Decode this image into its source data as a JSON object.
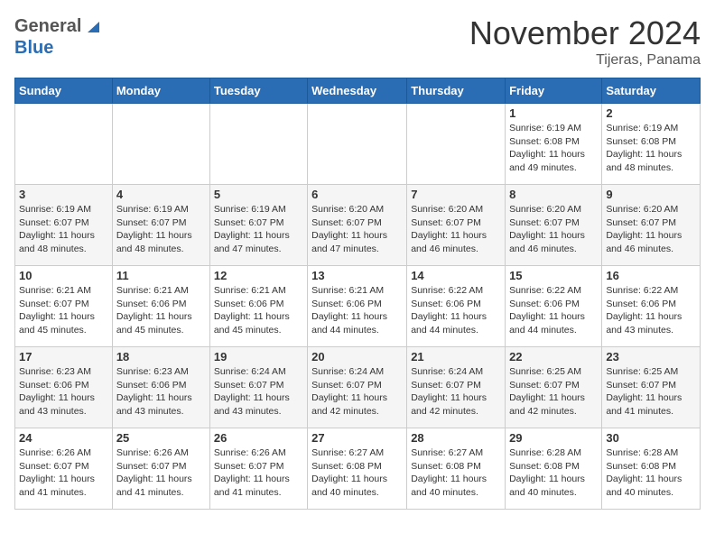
{
  "header": {
    "logo_general": "General",
    "logo_blue": "Blue",
    "month": "November 2024",
    "location": "Tijeras, Panama"
  },
  "days_of_week": [
    "Sunday",
    "Monday",
    "Tuesday",
    "Wednesday",
    "Thursday",
    "Friday",
    "Saturday"
  ],
  "weeks": [
    [
      {
        "day": "",
        "info": ""
      },
      {
        "day": "",
        "info": ""
      },
      {
        "day": "",
        "info": ""
      },
      {
        "day": "",
        "info": ""
      },
      {
        "day": "",
        "info": ""
      },
      {
        "day": "1",
        "info": "Sunrise: 6:19 AM\nSunset: 6:08 PM\nDaylight: 11 hours\nand 49 minutes."
      },
      {
        "day": "2",
        "info": "Sunrise: 6:19 AM\nSunset: 6:08 PM\nDaylight: 11 hours\nand 48 minutes."
      }
    ],
    [
      {
        "day": "3",
        "info": "Sunrise: 6:19 AM\nSunset: 6:07 PM\nDaylight: 11 hours\nand 48 minutes."
      },
      {
        "day": "4",
        "info": "Sunrise: 6:19 AM\nSunset: 6:07 PM\nDaylight: 11 hours\nand 48 minutes."
      },
      {
        "day": "5",
        "info": "Sunrise: 6:19 AM\nSunset: 6:07 PM\nDaylight: 11 hours\nand 47 minutes."
      },
      {
        "day": "6",
        "info": "Sunrise: 6:20 AM\nSunset: 6:07 PM\nDaylight: 11 hours\nand 47 minutes."
      },
      {
        "day": "7",
        "info": "Sunrise: 6:20 AM\nSunset: 6:07 PM\nDaylight: 11 hours\nand 46 minutes."
      },
      {
        "day": "8",
        "info": "Sunrise: 6:20 AM\nSunset: 6:07 PM\nDaylight: 11 hours\nand 46 minutes."
      },
      {
        "day": "9",
        "info": "Sunrise: 6:20 AM\nSunset: 6:07 PM\nDaylight: 11 hours\nand 46 minutes."
      }
    ],
    [
      {
        "day": "10",
        "info": "Sunrise: 6:21 AM\nSunset: 6:07 PM\nDaylight: 11 hours\nand 45 minutes."
      },
      {
        "day": "11",
        "info": "Sunrise: 6:21 AM\nSunset: 6:06 PM\nDaylight: 11 hours\nand 45 minutes."
      },
      {
        "day": "12",
        "info": "Sunrise: 6:21 AM\nSunset: 6:06 PM\nDaylight: 11 hours\nand 45 minutes."
      },
      {
        "day": "13",
        "info": "Sunrise: 6:21 AM\nSunset: 6:06 PM\nDaylight: 11 hours\nand 44 minutes."
      },
      {
        "day": "14",
        "info": "Sunrise: 6:22 AM\nSunset: 6:06 PM\nDaylight: 11 hours\nand 44 minutes."
      },
      {
        "day": "15",
        "info": "Sunrise: 6:22 AM\nSunset: 6:06 PM\nDaylight: 11 hours\nand 44 minutes."
      },
      {
        "day": "16",
        "info": "Sunrise: 6:22 AM\nSunset: 6:06 PM\nDaylight: 11 hours\nand 43 minutes."
      }
    ],
    [
      {
        "day": "17",
        "info": "Sunrise: 6:23 AM\nSunset: 6:06 PM\nDaylight: 11 hours\nand 43 minutes."
      },
      {
        "day": "18",
        "info": "Sunrise: 6:23 AM\nSunset: 6:06 PM\nDaylight: 11 hours\nand 43 minutes."
      },
      {
        "day": "19",
        "info": "Sunrise: 6:24 AM\nSunset: 6:07 PM\nDaylight: 11 hours\nand 43 minutes."
      },
      {
        "day": "20",
        "info": "Sunrise: 6:24 AM\nSunset: 6:07 PM\nDaylight: 11 hours\nand 42 minutes."
      },
      {
        "day": "21",
        "info": "Sunrise: 6:24 AM\nSunset: 6:07 PM\nDaylight: 11 hours\nand 42 minutes."
      },
      {
        "day": "22",
        "info": "Sunrise: 6:25 AM\nSunset: 6:07 PM\nDaylight: 11 hours\nand 42 minutes."
      },
      {
        "day": "23",
        "info": "Sunrise: 6:25 AM\nSunset: 6:07 PM\nDaylight: 11 hours\nand 41 minutes."
      }
    ],
    [
      {
        "day": "24",
        "info": "Sunrise: 6:26 AM\nSunset: 6:07 PM\nDaylight: 11 hours\nand 41 minutes."
      },
      {
        "day": "25",
        "info": "Sunrise: 6:26 AM\nSunset: 6:07 PM\nDaylight: 11 hours\nand 41 minutes."
      },
      {
        "day": "26",
        "info": "Sunrise: 6:26 AM\nSunset: 6:07 PM\nDaylight: 11 hours\nand 41 minutes."
      },
      {
        "day": "27",
        "info": "Sunrise: 6:27 AM\nSunset: 6:08 PM\nDaylight: 11 hours\nand 40 minutes."
      },
      {
        "day": "28",
        "info": "Sunrise: 6:27 AM\nSunset: 6:08 PM\nDaylight: 11 hours\nand 40 minutes."
      },
      {
        "day": "29",
        "info": "Sunrise: 6:28 AM\nSunset: 6:08 PM\nDaylight: 11 hours\nand 40 minutes."
      },
      {
        "day": "30",
        "info": "Sunrise: 6:28 AM\nSunset: 6:08 PM\nDaylight: 11 hours\nand 40 minutes."
      }
    ]
  ]
}
